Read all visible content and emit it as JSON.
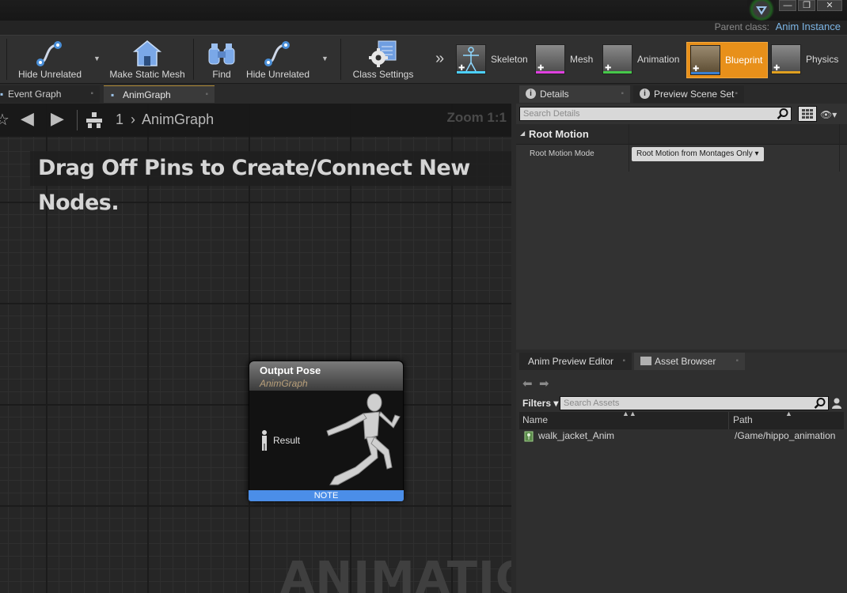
{
  "window": {
    "parent_class_label": "Parent class:",
    "parent_class_value": "Anim Instance",
    "controls": [
      "—",
      "❐",
      "✕"
    ]
  },
  "toolbar": {
    "buttons": [
      {
        "label": "Hide Unrelated",
        "icon": "hide-unrelated-icon"
      },
      {
        "label": "Make Static Mesh",
        "icon": "make-static-mesh-icon"
      },
      {
        "label": "Find",
        "icon": "find-binoculars-icon"
      },
      {
        "label": "Hide Unrelated",
        "icon": "hide-unrelated-icon"
      },
      {
        "label": "Class Settings",
        "icon": "class-settings-gear-icon"
      }
    ],
    "expand": "»",
    "modes": [
      {
        "label": "Skeleton",
        "accent": "#4cd0ff"
      },
      {
        "label": "Mesh",
        "accent": "#e040e0"
      },
      {
        "label": "Animation",
        "accent": "#46c84a"
      },
      {
        "label": "Blueprint",
        "accent": "#3a7fd0"
      },
      {
        "label": "Physics",
        "accent": "#e0a020"
      }
    ],
    "active_mode_color": "#e8901a"
  },
  "tabs": [
    {
      "label": "Event Graph"
    },
    {
      "label": "AnimGraph"
    }
  ],
  "graph": {
    "breadcrumb_index": "1",
    "breadcrumb_sep": "›",
    "breadcrumb_label": "AnimGraph",
    "zoom": "Zoom 1:1",
    "hint": "Drag Off Pins to Create/Connect New Nodes.",
    "watermark": "ANIMATION",
    "node": {
      "title": "Output Pose",
      "subtitle": "AnimGraph",
      "pin_label": "Result",
      "footer": "NOTE"
    }
  },
  "details_panel": {
    "tabs": [
      {
        "label": "Details"
      },
      {
        "label": "Preview Scene Set"
      }
    ],
    "search_placeholder": "Search Details",
    "category": "Root Motion",
    "property_name": "Root Motion Mode",
    "property_value": "Root Motion from Montages Only"
  },
  "asset_panel": {
    "tabs": [
      {
        "label": "Anim Preview Editor"
      },
      {
        "label": "Asset Browser"
      }
    ],
    "filters_label": "Filters",
    "search_placeholder": "Search Assets",
    "columns": [
      "Name",
      "Path"
    ],
    "rows": [
      {
        "name": "walk_jacket_Anim",
        "path": "/Game/hippo_animation"
      }
    ]
  }
}
